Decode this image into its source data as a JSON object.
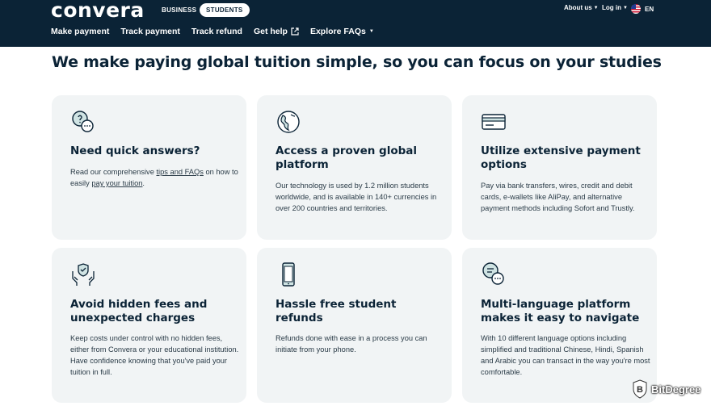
{
  "header": {
    "logo": "convera",
    "segment_business": "BUSINESS",
    "segment_students": "STUDENTS",
    "about_us": "About us",
    "log_in": "Log in",
    "language": "EN",
    "nav": {
      "make_payment": "Make payment",
      "track_payment": "Track payment",
      "track_refund": "Track refund",
      "get_help": "Get help",
      "explore_faqs": "Explore FAQs"
    }
  },
  "headline": "We make paying global tuition simple, so you can focus on your studies",
  "cards": {
    "c1": {
      "title": "Need quick answers?",
      "text_before": "Read our comprehensive ",
      "link1": "tips and FAQs",
      "text_middle": " on how to easily ",
      "link2": "pay your tuition",
      "text_after": ".",
      "icon": "chat-question-icon"
    },
    "c2": {
      "title": "Access a proven global platform",
      "text": "Our technology is used by 1.2 million students worldwide, and is available in 140+ currencies in over 200 countries and territories.",
      "icon": "globe-icon"
    },
    "c3": {
      "title": "Utilize extensive payment options",
      "text": "Pay via bank transfers, wires, credit and debit cards, e-wallets like AliPay, and alternative payment methods including Sofort and Trustly.",
      "icon": "credit-card-icon"
    },
    "c4": {
      "title": "Avoid hidden fees and unexpected charges",
      "text": "Keep costs under control with no hidden fees, either from Convera or your educational institution. Have confidence knowing that you've paid your tuition in full.",
      "icon": "hands-shield-icon"
    },
    "c5": {
      "title": "Hassle free student refunds",
      "text": "Refunds done with ease in a process you can initiate from your phone.",
      "icon": "mobile-phone-icon"
    },
    "c6": {
      "title": "Multi-language platform makes it easy to navigate",
      "text": "With 10 different language options including simplified and traditional Chinese, Hindi, Spanish and Arabic you can transact in the way you're most comfortable.",
      "icon": "chat-bubbles-icon"
    }
  },
  "watermark": "BitDegree",
  "colors": {
    "header_bg": "#0b2336",
    "card_bg": "#f1f4f5",
    "icon_stroke": "#0b2336",
    "icon_accent": "#cfe3e3"
  }
}
